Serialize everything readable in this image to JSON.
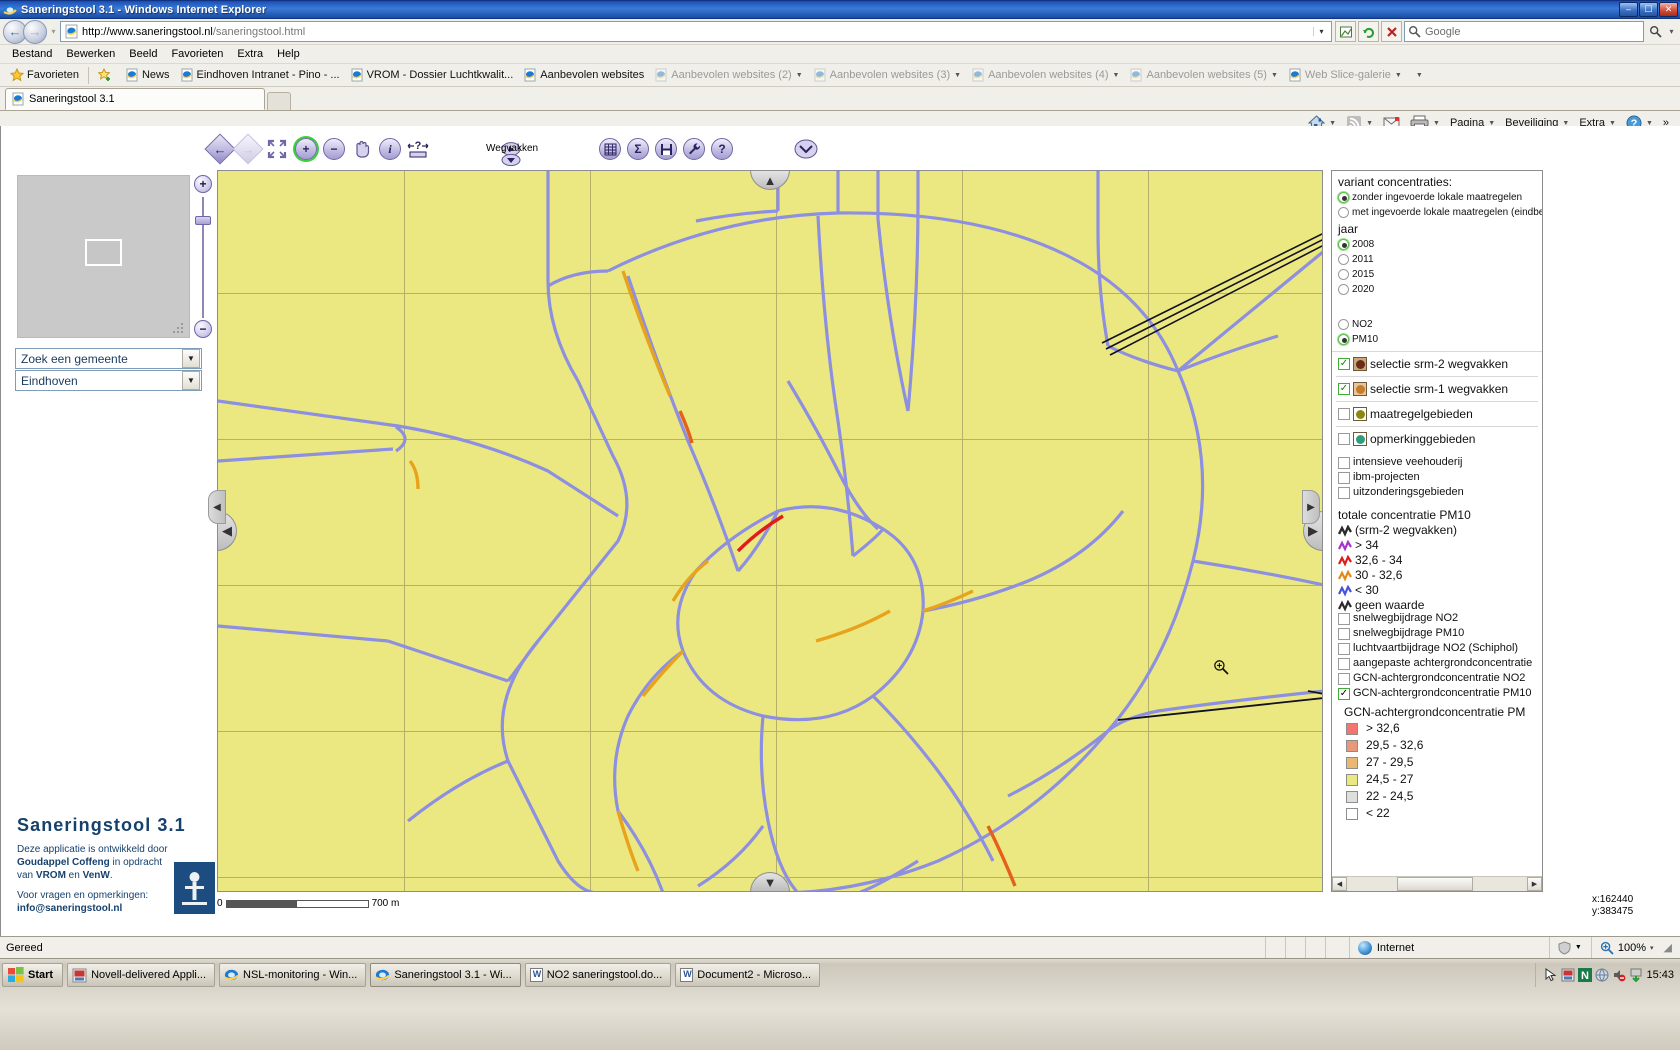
{
  "window": {
    "title": "Saneringstool 3.1 - Windows Internet Explorer",
    "minimize": "–",
    "maximize": "☐",
    "close": "✕"
  },
  "address": {
    "url_domain": "http://www.saneringstool.nl",
    "url_path": "/saneringstool.html",
    "back_icon": "←",
    "forward_icon": "→",
    "refresh_icon": "↻",
    "stop_icon": "✕",
    "search_placeholder": "Google",
    "search_icon": "search-icon"
  },
  "menu": [
    "Bestand",
    "Bewerken",
    "Beeld",
    "Favorieten",
    "Extra",
    "Help"
  ],
  "favorites": {
    "label": "Favorieten",
    "items": [
      {
        "label": "News",
        "dim": false,
        "caret": false
      },
      {
        "label": "Eindhoven Intranet - Pino - ...",
        "dim": false,
        "caret": false
      },
      {
        "label": "VROM - Dossier Luchtkwalit...",
        "dim": false,
        "caret": false
      },
      {
        "label": "Aanbevolen websites",
        "dim": false,
        "caret": false
      },
      {
        "label": "Aanbevolen websites (2)",
        "dim": true,
        "caret": true
      },
      {
        "label": "Aanbevolen websites (3)",
        "dim": true,
        "caret": true
      },
      {
        "label": "Aanbevolen websites (4)",
        "dim": true,
        "caret": true
      },
      {
        "label": "Aanbevolen websites (5)",
        "dim": true,
        "caret": true
      },
      {
        "label": "Web Slice-galerie",
        "dim": true,
        "caret": true
      }
    ]
  },
  "tab": {
    "label": "Saneringstool 3.1"
  },
  "commandbar": {
    "home_icon": "home-icon",
    "feeds_icon": "feeds-icon",
    "mail_icon": "mail-icon",
    "print_icon": "print-icon",
    "page": "Pagina",
    "security": "Beveiliging",
    "tools": "Extra",
    "help": "?"
  },
  "toolbar": {
    "back": "←",
    "forward": "→",
    "zoom_full": "⤢",
    "zoom_in": "+",
    "zoom_out": "−",
    "pan": "pan-hand-icon",
    "info": "i",
    "measure": "?",
    "wegvakken_label": "Wegvakken",
    "table": "table-icon",
    "sum": "Σ",
    "save": "save-icon",
    "tools": "wrench-icon",
    "help": "?",
    "expand": "⌄"
  },
  "leftpanel": {
    "overview_label": "overview-map",
    "zoom_in": "+",
    "zoom_out": "−",
    "search_combo": {
      "value": "Zoek een gemeente",
      "arrow": "▼"
    },
    "gemeente_combo": {
      "value": "Eindhoven",
      "arrow": "▼"
    },
    "brand_title": "Saneringstool 3.1",
    "credit_line1_a": "Deze applicatie is ontwikkeld door",
    "credit_line2_a": "Goudappel Coffeng",
    "credit_line2_b": " in opdracht",
    "credit_line3_a": "van ",
    "credit_line3_b": "VROM",
    "credit_line3_c": " en ",
    "credit_line3_d": "VenW",
    "credit_line3_e": ".",
    "contact_label": "Voor vragen en opmerkingen:",
    "contact_email": "info@saneringstool.nl"
  },
  "map": {
    "scale_zero": "0",
    "scale_max": "700 m",
    "coord_x": "x:162440",
    "coord_y": "y:383475",
    "nav_up": "▲",
    "nav_down": "▼",
    "nav_left": "◀",
    "nav_right": "▶",
    "background_color": "#ece881",
    "road_color": "#8d8fe0"
  },
  "legend": {
    "variant_title": "variant concentraties:",
    "variant_options": [
      {
        "label": "zonder ingevoerde lokale maatregelen",
        "selected": true
      },
      {
        "label": "met ingevoerde lokale maatregelen (eindbeeld)",
        "selected": false
      }
    ],
    "jaar_title": "jaar",
    "jaar_options": [
      {
        "label": "2008",
        "selected": true
      },
      {
        "label": "2011",
        "selected": false
      },
      {
        "label": "2015",
        "selected": false
      },
      {
        "label": "2020",
        "selected": false
      }
    ],
    "stof_options": [
      {
        "label": "NO2",
        "selected": false
      },
      {
        "label": "PM10",
        "selected": true
      }
    ],
    "layers": [
      {
        "label": "selectie srm-2 wegvakken",
        "checked": true,
        "swatch": "#6b2b14",
        "box": "#c8a87e"
      },
      {
        "label": "selectie srm-1 wegvakken",
        "checked": true,
        "swatch": "#c87c2a",
        "box": "#e6c79b"
      },
      {
        "label": "maatregelgebieden",
        "checked": false,
        "swatch": "#8a8a10",
        "box": "#ffffff"
      },
      {
        "label": "opmerkinggebieden",
        "checked": false,
        "swatch": "#2f9e7e",
        "box": "#ffffff"
      }
    ],
    "simple_layers": [
      {
        "label": "intensieve veehouderij",
        "checked": false
      },
      {
        "label": "ibm-projecten",
        "checked": false
      },
      {
        "label": "uitzonderingsgebieden",
        "checked": false
      }
    ],
    "conc_title": "totale concentratie PM10",
    "conc_subtitle": "(srm-2 wegvakken)",
    "conc_classes": [
      {
        "label": "(srm-2 wegvakken)",
        "color": "#000000",
        "header": true
      },
      {
        "label": "> 34",
        "color": "#a733cf"
      },
      {
        "label": "32,6 - 34",
        "color": "#e01b1b"
      },
      {
        "label": "30 - 32,6",
        "color": "#e08a16"
      },
      {
        "label": "< 30",
        "color": "#4a52d8"
      },
      {
        "label": "geen waarde",
        "color": "#2b2b2b"
      }
    ],
    "contrib_layers": [
      {
        "label": "snelwegbijdrage NO2",
        "checked": false
      },
      {
        "label": "snelwegbijdrage PM10",
        "checked": false
      },
      {
        "label": "luchtvaartbijdrage NO2 (Schiphol)",
        "checked": false
      },
      {
        "label": "aangepaste achtergrondconcentratie",
        "checked": false
      },
      {
        "label": "GCN-achtergrondconcentratie NO2",
        "checked": false
      },
      {
        "label": "GCN-achtergrondconcentratie PM10",
        "checked": true
      }
    ],
    "gcn_title": "GCN-achtergrondconcentratie PM",
    "gcn_classes": [
      {
        "label": "> 32,6",
        "color": "#f4746f"
      },
      {
        "label": "29,5 - 32,6",
        "color": "#e8997a"
      },
      {
        "label": "27 - 29,5",
        "color": "#e8b874"
      },
      {
        "label": "24,5 - 27",
        "color": "#ece881"
      },
      {
        "label": "22 - 24,5",
        "color": "#dededa"
      },
      {
        "label": "< 22",
        "color": "#ffffff"
      }
    ],
    "scroll_left": "◀",
    "scroll_right": "▶"
  },
  "statusbar": {
    "text": "Gereed",
    "zone": "Internet",
    "zoom": "100%",
    "zoom_caret": "▾"
  },
  "taskbar": {
    "start": "Start",
    "items": [
      {
        "label": "Novell-delivered Appli...",
        "icon": "novell-icon",
        "active": false
      },
      {
        "label": "NSL-monitoring - Win...",
        "icon": "ie-icon",
        "active": false
      },
      {
        "label": "Saneringstool 3.1 - Wi...",
        "icon": "ie-icon",
        "active": true
      },
      {
        "label": "NO2 saneringstool.do...",
        "icon": "word-icon",
        "active": false
      },
      {
        "label": "Document2 - Microso...",
        "icon": "word-icon",
        "active": false
      }
    ],
    "clock": "15:43"
  }
}
